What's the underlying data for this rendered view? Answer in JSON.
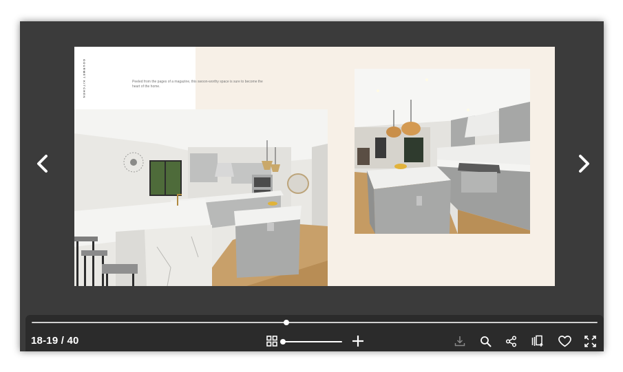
{
  "spread": {
    "vertical_title": "GOURMET KITCHEN",
    "caption": "Peeled from the pages of a magazine, this swoon-worthy space is sure to become the heart of the home."
  },
  "navigation": {
    "prev_icon": "chevron-left-icon",
    "next_icon": "chevron-right-icon"
  },
  "toolbar": {
    "page_counter": "18-19 / 40",
    "page_progress": 0.45,
    "zoom_level": 0,
    "icons": [
      "grid-icon",
      "zoom-in-icon",
      "download-icon",
      "search-icon",
      "share-icon",
      "add-page-icon",
      "heart-icon",
      "fullscreen-icon"
    ]
  },
  "colors": {
    "viewer_background": "#3b3b3b",
    "toolbar_background": "#2b2b2b",
    "page_background": "#f7f0e7",
    "icon": "#ffffff",
    "icon_disabled": "#8a8a8a"
  }
}
